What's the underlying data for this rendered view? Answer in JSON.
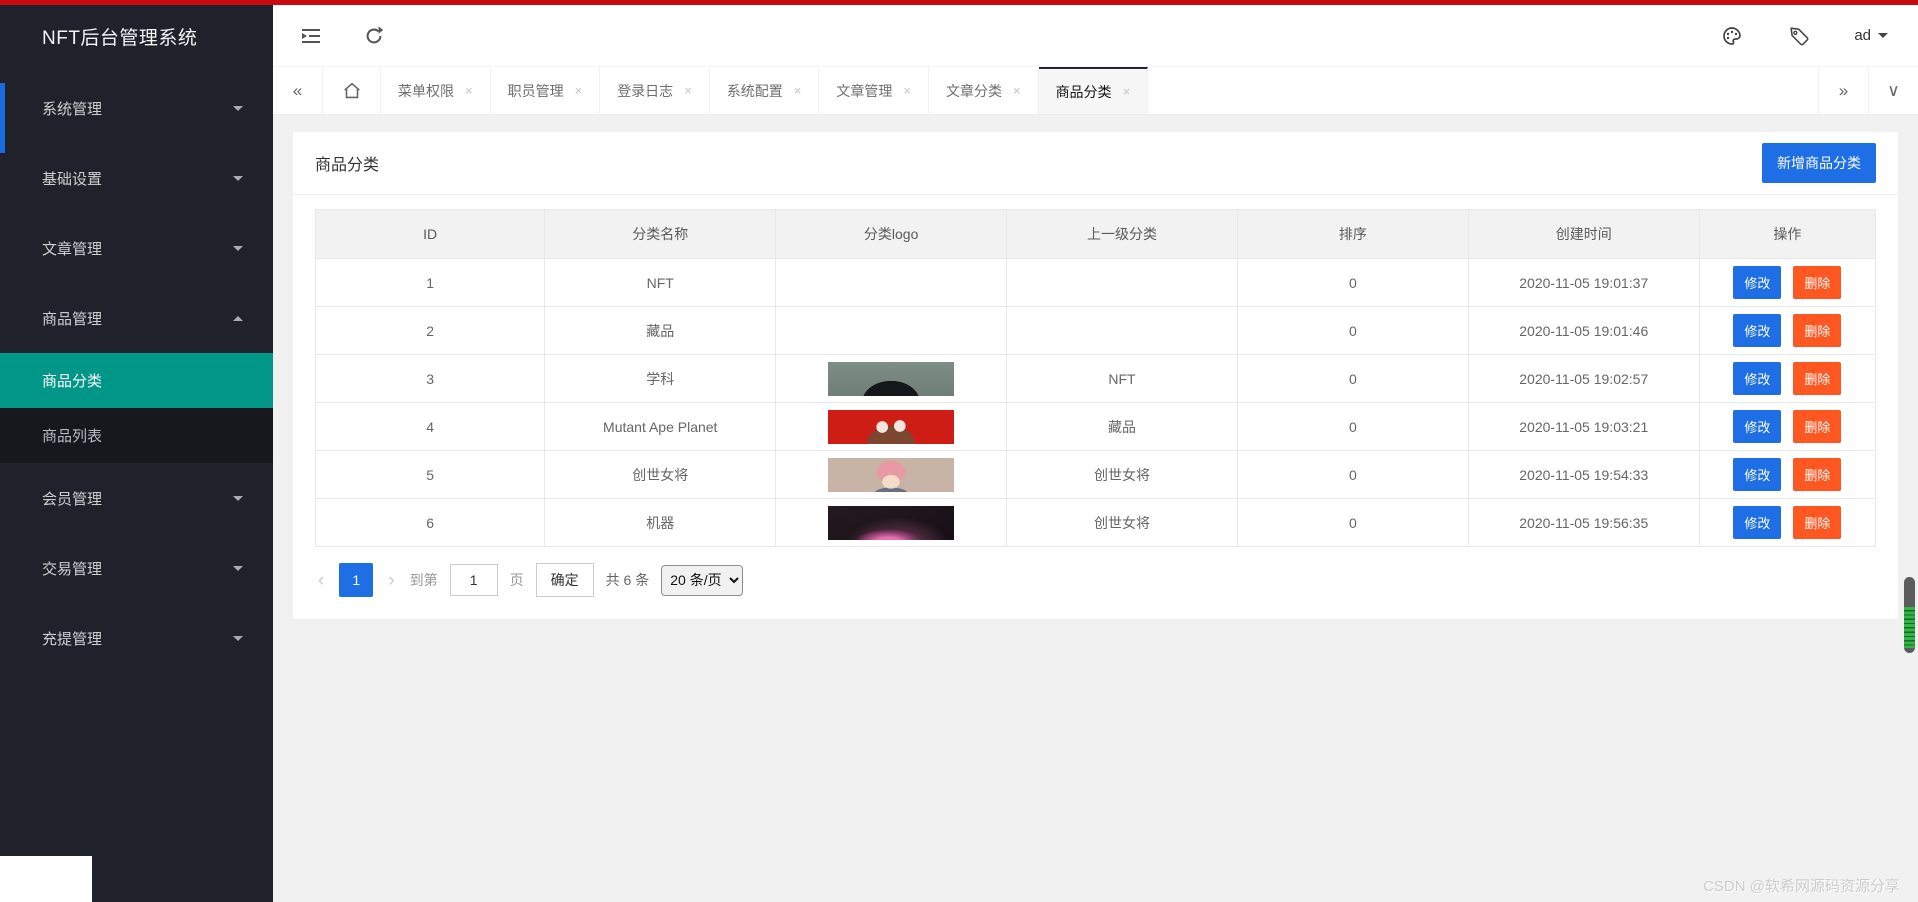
{
  "app": {
    "title": "NFT后台管理系统",
    "user": "ad",
    "watermark": "CSDN @软希网源码资源分享"
  },
  "colors": {
    "accent_blue": "#1e6ee5",
    "danger_orange": "#ff5722",
    "active_teal": "#009688",
    "top_bar_red": "#cb0a10"
  },
  "glyphs": {
    "collapse_tabs": "«",
    "expand_tabs": "»",
    "tab_menu": "∨",
    "close": "×",
    "pg_prev": "‹",
    "pg_next": "›"
  },
  "sidebar": {
    "groups": [
      {
        "label": "系统管理",
        "state": "collapsed"
      },
      {
        "label": "基础设置",
        "state": "collapsed"
      },
      {
        "label": "文章管理",
        "state": "collapsed"
      },
      {
        "label": "商品管理",
        "state": "expanded",
        "children": [
          {
            "label": "商品分类",
            "active": true
          },
          {
            "label": "商品列表",
            "active": false
          }
        ]
      },
      {
        "label": "会员管理",
        "state": "collapsed"
      },
      {
        "label": "交易管理",
        "state": "collapsed"
      },
      {
        "label": "充提管理",
        "state": "collapsed"
      }
    ]
  },
  "tabs": {
    "items": [
      {
        "label": "菜单权限",
        "active": false
      },
      {
        "label": "职员管理",
        "active": false
      },
      {
        "label": "登录日志",
        "active": false
      },
      {
        "label": "系统配置",
        "active": false
      },
      {
        "label": "文章管理",
        "active": false
      },
      {
        "label": "文章分类",
        "active": false
      },
      {
        "label": "商品分类",
        "active": true
      }
    ]
  },
  "page": {
    "title": "商品分类",
    "add_button": "新增商品分类"
  },
  "table": {
    "headers": [
      "ID",
      "分类名称",
      "分类logo",
      "上一级分类",
      "排序",
      "创建时间",
      "操作"
    ],
    "actions": {
      "edit": "修改",
      "delete": "删除"
    },
    "rows": [
      {
        "id": "1",
        "name": "NFT",
        "logo": null,
        "parent": "",
        "sort": "0",
        "created": "2020-11-05 19:01:37"
      },
      {
        "id": "2",
        "name": "藏品",
        "logo": null,
        "parent": "",
        "sort": "0",
        "created": "2020-11-05 19:01:46"
      },
      {
        "id": "3",
        "name": "学科",
        "logo": "grey-green",
        "parent": "NFT",
        "sort": "0",
        "created": "2020-11-05 19:02:57"
      },
      {
        "id": "4",
        "name": "Mutant Ape Planet",
        "logo": "red-ape",
        "parent": "藏品",
        "sort": "0",
        "created": "2020-11-05 19:03:21"
      },
      {
        "id": "5",
        "name": "创世女将",
        "logo": "beige-girl",
        "parent": "创世女将",
        "sort": "0",
        "created": "2020-11-05 19:54:33"
      },
      {
        "id": "6",
        "name": "机器",
        "logo": "dark-pink",
        "parent": "创世女将",
        "sort": "0",
        "created": "2020-11-05 19:56:35"
      }
    ]
  },
  "pagination": {
    "current": "1",
    "goto_label": "到第",
    "page_input": "1",
    "page_unit": "页",
    "confirm": "确定",
    "total": "共 6 条",
    "per_page": "20 条/页"
  }
}
